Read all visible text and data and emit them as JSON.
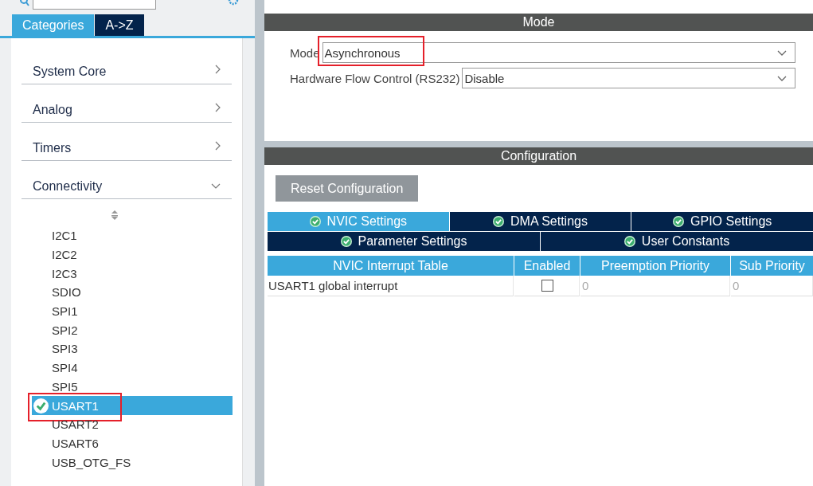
{
  "tabs": [
    {
      "label": "Categories",
      "selected": true
    },
    {
      "label": "A->Z",
      "selected": false
    }
  ],
  "categories": [
    {
      "label": "System Core",
      "expanded": false
    },
    {
      "label": "Analog",
      "expanded": false
    },
    {
      "label": "Timers",
      "expanded": false
    },
    {
      "label": "Connectivity",
      "expanded": true,
      "children": [
        {
          "label": "I2C1",
          "selected": false,
          "checked": false,
          "highlighted": false
        },
        {
          "label": "I2C2",
          "selected": false,
          "checked": false,
          "highlighted": false
        },
        {
          "label": "I2C3",
          "selected": false,
          "checked": false,
          "highlighted": false
        },
        {
          "label": "SDIO",
          "selected": false,
          "checked": false,
          "highlighted": false
        },
        {
          "label": "SPI1",
          "selected": false,
          "checked": false,
          "highlighted": false
        },
        {
          "label": "SPI2",
          "selected": false,
          "checked": false,
          "highlighted": false
        },
        {
          "label": "SPI3",
          "selected": false,
          "checked": false,
          "highlighted": false
        },
        {
          "label": "SPI4",
          "selected": false,
          "checked": false,
          "highlighted": false
        },
        {
          "label": "SPI5",
          "selected": false,
          "checked": false,
          "highlighted": false
        },
        {
          "label": "USART1",
          "selected": true,
          "checked": true,
          "highlighted": true
        },
        {
          "label": "USART2",
          "selected": false,
          "checked": false,
          "highlighted": false
        },
        {
          "label": "USART6",
          "selected": false,
          "checked": false,
          "highlighted": false
        },
        {
          "label": "USB_OTG_FS",
          "selected": false,
          "checked": false,
          "highlighted": false
        }
      ]
    }
  ],
  "mode": {
    "header": "Mode",
    "fields": [
      {
        "label": "Mode",
        "value": "Asynchronous",
        "highlighted": true
      },
      {
        "label": "Hardware Flow Control (RS232)",
        "value": "Disable",
        "highlighted": false
      }
    ]
  },
  "configuration": {
    "header": "Configuration",
    "reset_button": "Reset Configuration",
    "tab_rows": [
      [
        {
          "label": "NVIC Settings",
          "selected": true,
          "checked": true
        },
        {
          "label": "DMA Settings",
          "selected": false,
          "checked": true
        },
        {
          "label": "GPIO Settings",
          "selected": false,
          "checked": true
        }
      ],
      [
        {
          "label": "Parameter Settings",
          "selected": false,
          "checked": true
        },
        {
          "label": "User Constants",
          "selected": false,
          "checked": true
        }
      ]
    ],
    "table": {
      "columns": [
        "NVIC Interrupt Table",
        "Enabled",
        "Preemption Priority",
        "Sub Priority"
      ],
      "rows": [
        {
          "name": "USART1 global interrupt",
          "enabled": false,
          "preemption_priority": "0",
          "sub_priority": "0"
        }
      ]
    }
  }
}
